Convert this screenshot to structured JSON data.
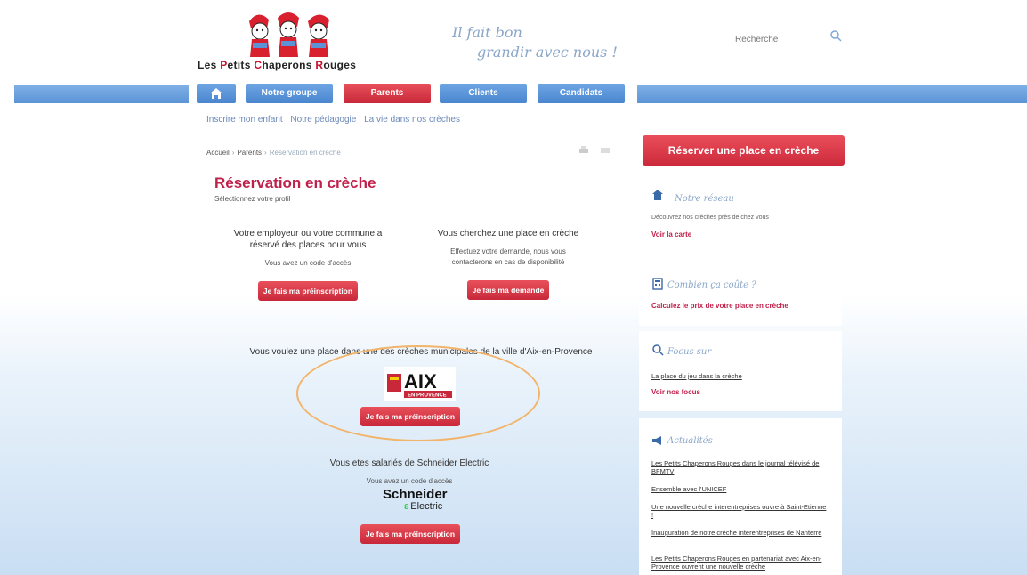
{
  "header": {
    "logo": {
      "part1": "Les ",
      "p": "P",
      "part2": "etits ",
      "c": "C",
      "part3": "haperons ",
      "r": "R",
      "part4": "ouges"
    },
    "slogan_line1": "Il fait bon",
    "slogan_line2": "grandir avec nous !",
    "search_placeholder": "Recherche"
  },
  "nav": {
    "items": [
      "Notre groupe",
      "Parents",
      "Clients",
      "Candidats"
    ],
    "active": "Parents",
    "sub_items": [
      "Inscrire mon enfant",
      "Notre pédagogie",
      "La vie dans nos crèches"
    ]
  },
  "breadcrumb": [
    "Accueil",
    "Parents",
    "Réservation en crèche"
  ],
  "main": {
    "title": "Réservation en crèche",
    "subtitle": "Sélectionnez votre profil",
    "option1": {
      "title": "Votre employeur ou votre commune a réservé des places pour vous",
      "text": "Vous avez un code d'accès",
      "button": "Je fais ma préinscription"
    },
    "option2": {
      "title": "Vous cherchez une place en crèche",
      "text": "Effectuez votre demande, nous vous contacterons en cas de disponibilité",
      "button": "Je fais ma demande"
    },
    "option3": {
      "title": "Vous voulez une place dans une des crèches municipales de la ville d'Aix-en-Provence",
      "logo_text": "AIX",
      "logo_sub": "EN PROVENCE",
      "button": "Je fais ma préinscription"
    },
    "option4": {
      "title": "Vous etes salariés de Schneider Electric",
      "text": "Vous avez un code d'accès",
      "logo_line1": "Schneider",
      "logo_line2": "Electric",
      "button": "Je fais ma préinscription"
    }
  },
  "sidebar": {
    "reserve_button": "Réserver une place en crèche",
    "reseau": {
      "title": "Notre réseau",
      "text": "Découvrez nos crèches près de chez vous",
      "link": "Voir la carte"
    },
    "cout": {
      "title": "Combien ça coûte ?",
      "link": "Calculez le prix de votre place en crèche"
    },
    "focus": {
      "title": "Focus sur",
      "ulink": "La place du jeu dans la crèche",
      "link": "Voir nos focus"
    },
    "actualites": {
      "title": "Actualités",
      "items": [
        "Les Petits Chaperons Rouges dans le journal télévisé de BFMTV",
        "Ensemble avec l'UNICEF",
        "Une nouvelle crèche interentreprises ouvre à Saint-Etienne !",
        "Inauguration de notre crèche interentreprises de Nanterre",
        "Les Petits Chaperons Rouges en partenariat avec Aix-en-Provence ouvrent une nouvelle crèche"
      ]
    }
  },
  "colors": {
    "brand_red": "#c8283a",
    "nav_blue": "#4a86cf",
    "title_red": "#c0214b",
    "highlight": "#f2b46a"
  }
}
